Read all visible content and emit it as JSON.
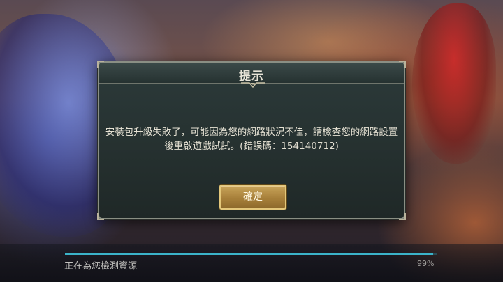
{
  "dialog": {
    "title": "提示",
    "message": "安裝包升級失敗了，可能因為您的網路狀況不佳，請檢查您的網路設置後重啟遊戲試試。(錯誤碼：154140712)",
    "confirm_label": "確定"
  },
  "loading": {
    "status_text": "正在為您檢測資源",
    "percent_text": "99%",
    "progress": 0.99,
    "accent_color": "#3bb3c9"
  }
}
